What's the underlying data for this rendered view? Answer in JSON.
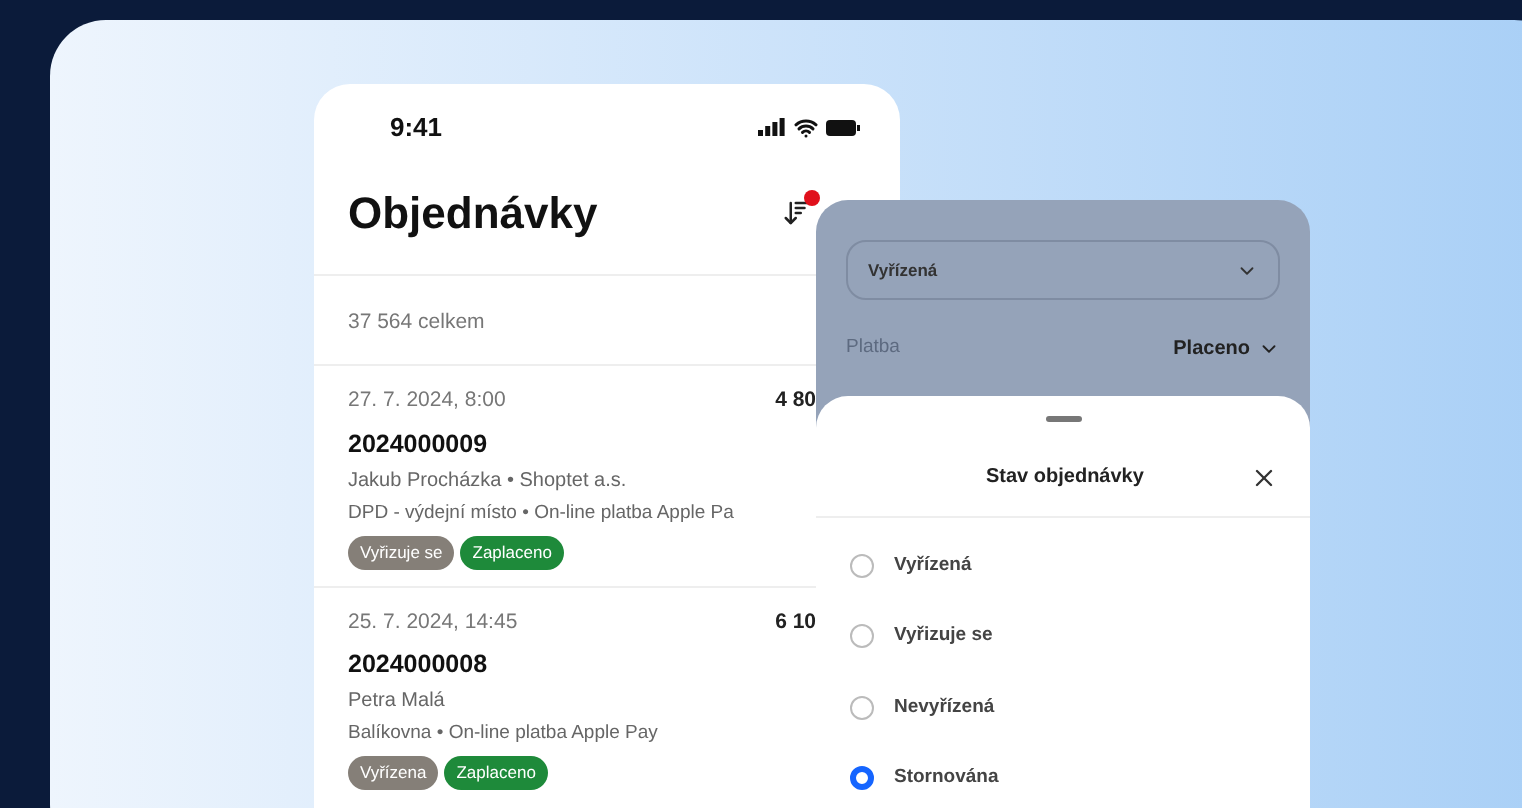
{
  "phone": {
    "time": "9:41",
    "title": "Objednávky",
    "sort_badge": true,
    "total": "37 564 celkem",
    "orders": [
      {
        "date": "27. 7. 2024, 8:00",
        "amount": "4 80",
        "number": "2024000009",
        "customer": "Jakub Procházka • Shoptet a.s.",
        "delivery": "DPD - výdejní místo • On-line platba Apple Pa",
        "tags": [
          {
            "label": "Vyřizuje se",
            "color": "#857f78"
          },
          {
            "label": "Zaplaceno",
            "color": "#1e8a3a"
          }
        ]
      },
      {
        "date": "25. 7. 2024, 14:45",
        "amount": "6 10",
        "number": "2024000008",
        "customer": "Petra Malá",
        "delivery": "Balíkovna • On-line platba Apple Pay",
        "tags": [
          {
            "label": "Vyřízena",
            "color": "#857f78"
          },
          {
            "label": "Zaplaceno",
            "color": "#1e8a3a"
          }
        ]
      }
    ]
  },
  "filter": {
    "status_select": "Vyřízená",
    "payment_label": "Platba",
    "payment_value": "Placeno"
  },
  "sheet": {
    "title": "Stav objednávky",
    "options": [
      {
        "label": "Vyřízená",
        "selected": false
      },
      {
        "label": "Vyřizuje se",
        "selected": false
      },
      {
        "label": "Nevyřízená",
        "selected": false
      },
      {
        "label": "Stornována",
        "selected": true
      }
    ]
  }
}
